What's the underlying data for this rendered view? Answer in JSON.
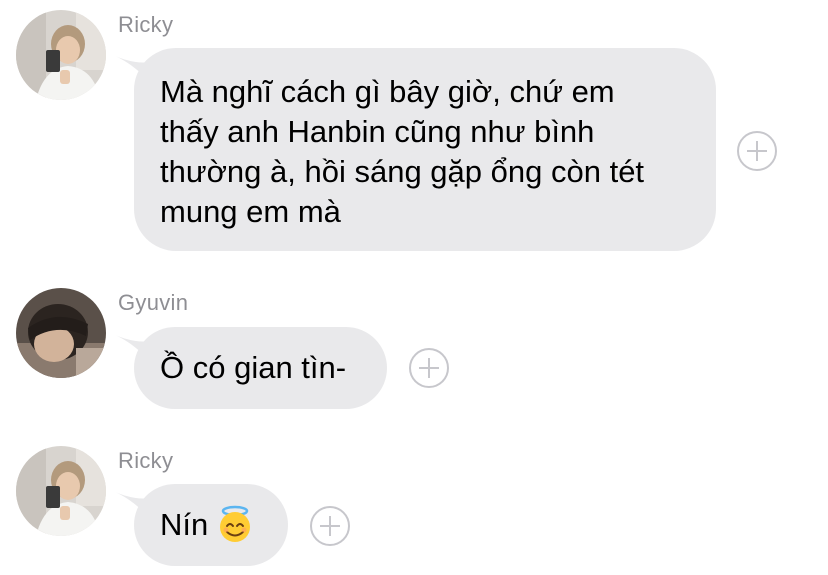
{
  "messages": [
    {
      "sender": "Ricky",
      "text": "Mà nghĩ cách gì bây giờ, chứ em\nthấy anh Hanbin cũng như bình\nthường à, hồi sáng gặp ổng còn tét\nmung em mà",
      "avatar_icon": "avatar-ricky",
      "react_icon": "add-reaction-icon"
    },
    {
      "sender": "Gyuvin",
      "text": "Ồ có gian tìn-",
      "avatar_icon": "avatar-gyuvin",
      "react_icon": "add-reaction-icon"
    },
    {
      "sender": "Ricky",
      "text": "Nín",
      "emoji_icon": "smiling-face-with-halo-emoji",
      "avatar_icon": "avatar-ricky",
      "react_icon": "add-reaction-icon"
    }
  ],
  "colors": {
    "bubble": "#e9e9eb",
    "sender_name": "#8e8e93",
    "react_button": "#c7c7cc",
    "background": "#ffffff"
  }
}
